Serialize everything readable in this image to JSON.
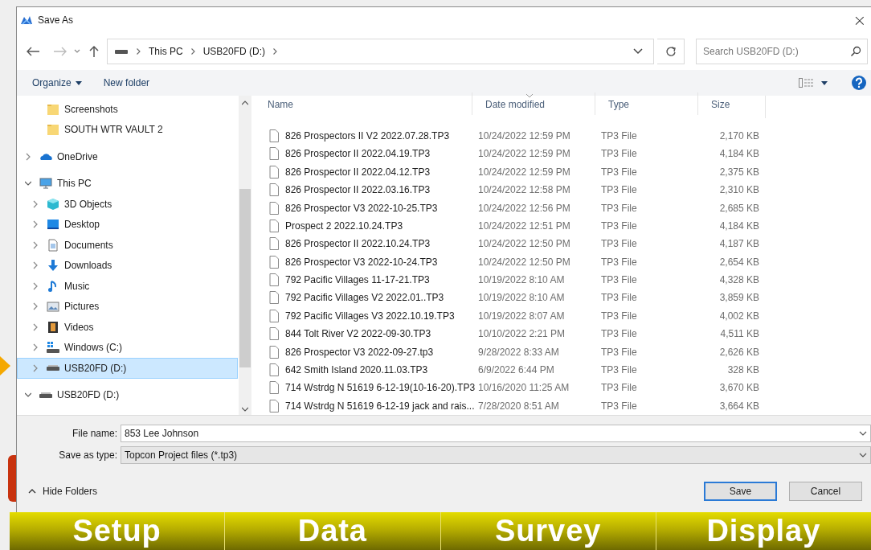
{
  "window": {
    "title": "Save As",
    "close": "×"
  },
  "address_bar": {
    "path": [
      "This PC",
      "USB20FD (D:)"
    ]
  },
  "search": {
    "placeholder": "Search USB20FD (D:)"
  },
  "toolbar": {
    "organize": "Organize",
    "new_folder": "New folder"
  },
  "nav_pane": {
    "continued_items": [
      {
        "kind": "folder",
        "label": "Screenshots"
      },
      {
        "kind": "folder",
        "label": "SOUTH WTR VAULT 2"
      }
    ],
    "items": [
      {
        "kind": "onedrive",
        "label": "OneDrive",
        "expanded": false,
        "selected": false
      },
      {
        "kind": "pc",
        "label": "This PC",
        "expanded": true,
        "selected": false,
        "children": [
          {
            "kind": "cube",
            "label": "3D Objects",
            "expanded": false,
            "selected": false
          },
          {
            "kind": "desktop",
            "label": "Desktop",
            "expanded": false,
            "selected": false
          },
          {
            "kind": "documents",
            "label": "Documents",
            "expanded": false,
            "selected": false
          },
          {
            "kind": "downloads",
            "label": "Downloads",
            "expanded": false,
            "selected": false
          },
          {
            "kind": "music",
            "label": "Music",
            "expanded": false,
            "selected": false
          },
          {
            "kind": "pictures",
            "label": "Pictures",
            "expanded": false,
            "selected": false
          },
          {
            "kind": "videos",
            "label": "Videos",
            "expanded": false,
            "selected": false
          },
          {
            "kind": "windows-drive",
            "label": "Windows (C:)",
            "expanded": false,
            "selected": false
          },
          {
            "kind": "drive",
            "label": "USB20FD (D:)",
            "expanded": false,
            "selected": true
          }
        ]
      },
      {
        "kind": "drive",
        "label": "USB20FD (D:)",
        "expanded": true,
        "selected": false
      }
    ]
  },
  "file_list": {
    "columns": [
      "Name",
      "Date modified",
      "Type",
      "Size"
    ],
    "rows": [
      {
        "name": "826 Prospectors II V2 2022.07.28.TP3",
        "date": "10/24/2022 12:59 PM",
        "type": "TP3 File",
        "size": "2,170 KB"
      },
      {
        "name": "826 Prospector II 2022.04.19.TP3",
        "date": "10/24/2022 12:59 PM",
        "type": "TP3 File",
        "size": "4,184 KB"
      },
      {
        "name": "826 Prospector II 2022.04.12.TP3",
        "date": "10/24/2022 12:59 PM",
        "type": "TP3 File",
        "size": "2,375 KB"
      },
      {
        "name": "826 Prospector II 2022.03.16.TP3",
        "date": "10/24/2022 12:58 PM",
        "type": "TP3 File",
        "size": "2,310 KB"
      },
      {
        "name": "826 Prospector V3 2022-10-25.TP3",
        "date": "10/24/2022 12:56 PM",
        "type": "TP3 File",
        "size": "2,685 KB"
      },
      {
        "name": "Prospect 2 2022.10.24.TP3",
        "date": "10/24/2022 12:51 PM",
        "type": "TP3 File",
        "size": "4,184 KB"
      },
      {
        "name": "826 Prospector II 2022.10.24.TP3",
        "date": "10/24/2022 12:50 PM",
        "type": "TP3 File",
        "size": "4,187 KB"
      },
      {
        "name": "826 Prospector V3 2022-10-24.TP3",
        "date": "10/24/2022 12:50 PM",
        "type": "TP3 File",
        "size": "2,654 KB"
      },
      {
        "name": "792 Pacific Villages 11-17-21.TP3",
        "date": "10/19/2022 8:10 AM",
        "type": "TP3 File",
        "size": "4,328 KB"
      },
      {
        "name": "792 Pacific Villages V2 2022.01..TP3",
        "date": "10/19/2022 8:10 AM",
        "type": "TP3 File",
        "size": "3,859 KB"
      },
      {
        "name": "792 Pacific Villages V3 2022.10.19.TP3",
        "date": "10/19/2022 8:07 AM",
        "type": "TP3 File",
        "size": "4,002 KB"
      },
      {
        "name": "844 Tolt River V2 2022-09-30.TP3",
        "date": "10/10/2022 2:21 PM",
        "type": "TP3 File",
        "size": "4,511 KB"
      },
      {
        "name": "826 Prospector V3 2022-09-27.tp3",
        "date": "9/28/2022 8:33 AM",
        "type": "TP3 File",
        "size": "2,626 KB"
      },
      {
        "name": "642 Smith Island 2020.11.03.TP3",
        "date": "6/9/2022 6:44 PM",
        "type": "TP3 File",
        "size": "328 KB"
      },
      {
        "name": "714 Wstrdg N 51619 6-12-19(10-16-20).TP3",
        "date": "10/16/2020 11:25 AM",
        "type": "TP3 File",
        "size": "3,670 KB"
      },
      {
        "name": "714 Wstrdg N 51619 6-12-19 jack and rais...",
        "date": "7/28/2020 8:51 AM",
        "type": "TP3 File",
        "size": "3,664 KB"
      }
    ]
  },
  "file_name": {
    "label": "File name:",
    "value": "853 Lee Johnson"
  },
  "save_as_type": {
    "label": "Save as type:",
    "value": "Topcon Project files (*.tp3)"
  },
  "hide_folders": "Hide Folders",
  "buttons": {
    "save": "Save",
    "cancel": "Cancel"
  },
  "app_tabs": [
    "Setup",
    "Data",
    "Survey",
    "Display"
  ]
}
